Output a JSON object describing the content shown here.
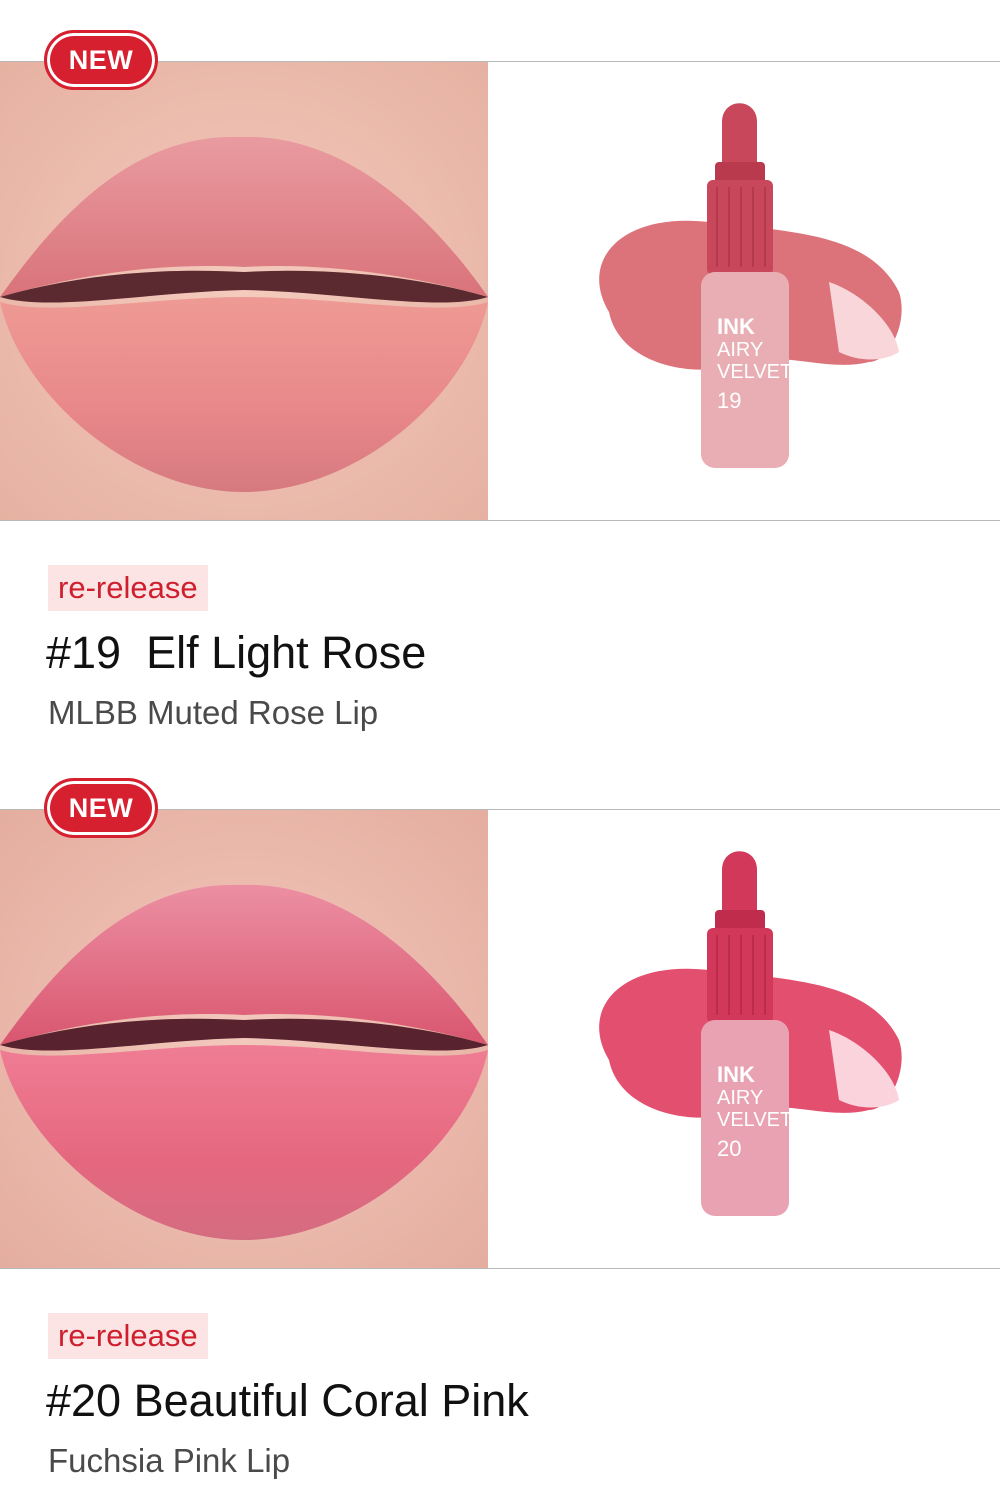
{
  "products": [
    {
      "badge": "NEW",
      "tag": "re-release",
      "title": "#19  Elf Light Rose",
      "subtitle": "MLBB Muted Rose Lip",
      "bottle": {
        "line1": "INK",
        "line2": "AIRY",
        "line3": "VELVET",
        "number": "19"
      },
      "colors": {
        "lip": "#e2858a",
        "lip_light": "#f0aab0",
        "swatch": "#d9646b",
        "cap": "#c9475a",
        "bottle": "#e9aeb4",
        "skin": "#f0c4b6"
      }
    },
    {
      "badge": "NEW",
      "tag": "re-release",
      "title": "#20 Beautiful Coral Pink",
      "subtitle": "Fuchsia Pink Lip",
      "bottle": {
        "line1": "INK",
        "line2": "AIRY",
        "line3": "VELVET",
        "number": "20"
      },
      "colors": {
        "lip": "#e2607a",
        "lip_light": "#f08aa0",
        "swatch": "#e03c5e",
        "cap": "#d2385a",
        "bottle": "#e8a2b2",
        "skin": "#efc2b6"
      }
    }
  ]
}
